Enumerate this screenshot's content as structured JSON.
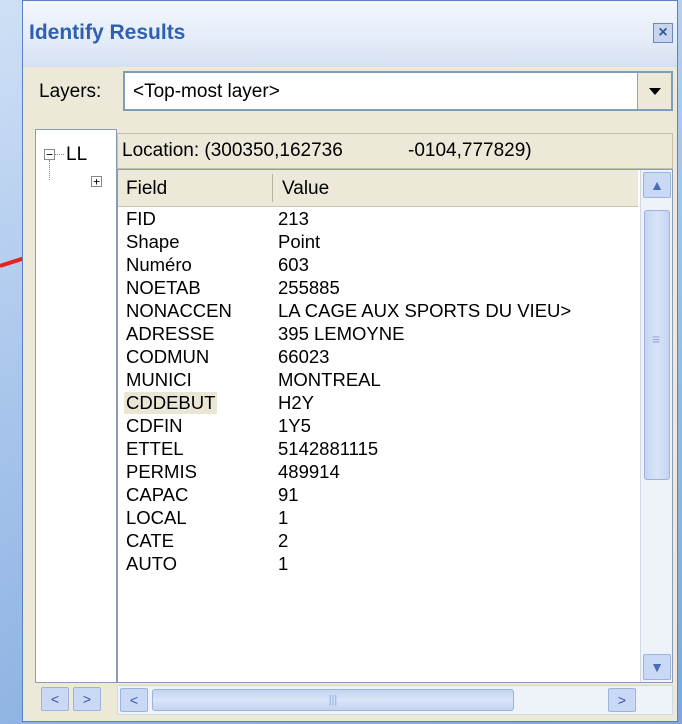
{
  "window": {
    "title": "Identify Results",
    "close_glyph": "×"
  },
  "layers": {
    "label": "Layers:",
    "selected": "<Top-most layer>"
  },
  "tree": {
    "root_expander": "−",
    "root_label": "LL",
    "child_expander": "+"
  },
  "location": {
    "label": "Location: (300350,162736",
    "value": "-0104,777829)"
  },
  "table": {
    "headers": {
      "field": "Field",
      "value": "Value"
    },
    "rows": [
      {
        "field": "FID",
        "value": "213"
      },
      {
        "field": "Shape",
        "value": "Point"
      },
      {
        "field": "Numéro",
        "value": "603"
      },
      {
        "field": "NOETAB",
        "value": "255885"
      },
      {
        "field": "NONACCEN",
        "value": "LA CAGE AUX SPORTS DU VIEU>"
      },
      {
        "field": "ADRESSE",
        "value": "395 LEMOYNE"
      },
      {
        "field": "CODMUN",
        "value": "66023"
      },
      {
        "field": "MUNICI",
        "value": "MONTREAL"
      },
      {
        "field": "CDDEBUT",
        "value": "H2Y"
      },
      {
        "field": "CDFIN",
        "value": "1Y5"
      },
      {
        "field": "ETTEL",
        "value": "5142881115"
      },
      {
        "field": "PERMIS",
        "value": "489914"
      },
      {
        "field": "CAPAC",
        "value": "91"
      },
      {
        "field": "LOCAL",
        "value": "1"
      },
      {
        "field": "CATE",
        "value": "2"
      },
      {
        "field": "AUTO",
        "value": "1"
      }
    ]
  },
  "scroll": {
    "up": "▲",
    "down": "▼",
    "left": "<",
    "right": ">",
    "grip_h": "|||",
    "grip_v": "≡"
  },
  "colors": {
    "title_text": "#2f5fb0",
    "arrow": "#e8231d",
    "highlight": "#eae6d6"
  }
}
